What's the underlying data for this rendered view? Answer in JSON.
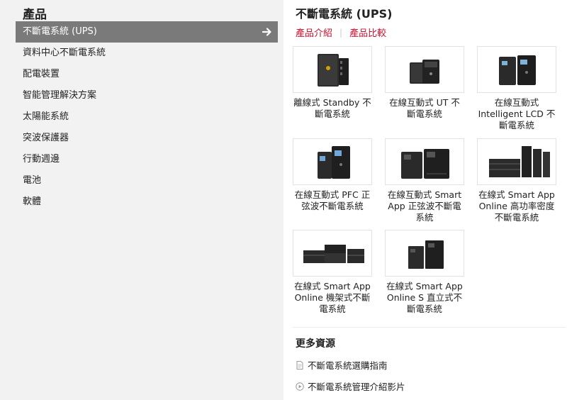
{
  "sidebar": {
    "title": "產品",
    "items": [
      {
        "label": "不斷電系統 (UPS)",
        "active": true
      },
      {
        "label": "資料中心不斷電系統"
      },
      {
        "label": "配電裝置"
      },
      {
        "label": "智能管理解決方案"
      },
      {
        "label": "太陽能系統"
      },
      {
        "label": "突波保護器"
      },
      {
        "label": "行動週邊"
      },
      {
        "label": "電池"
      },
      {
        "label": "軟體"
      }
    ]
  },
  "main": {
    "title": "不斷電系統 (UPS)",
    "tabs": [
      {
        "label": "產品介紹"
      },
      {
        "label": "產品比較"
      }
    ],
    "accent_color": "#c8102e",
    "products": [
      {
        "label": "離線式 Standby 不斷電系統",
        "image": "standby-ups-image"
      },
      {
        "label": "在線互動式 UT 不斷電系統",
        "image": "ut-ups-image"
      },
      {
        "label": "在線互動式 Intelligent LCD 不斷電系統",
        "image": "intelligent-lcd-ups-image"
      },
      {
        "label": "在線互動式 PFC 正弦波不斷電系統",
        "image": "pfc-ups-image"
      },
      {
        "label": "在線互動式 Smart App 正弦波不斷電系統",
        "image": "smart-app-sinewave-ups-image"
      },
      {
        "label": "在線式 Smart App Online 高功率密度不斷電系統",
        "image": "smart-app-online-high-density-ups-image"
      },
      {
        "label": "在線式 Smart App Online 機架式不斷電系統",
        "image": "smart-app-online-rackmount-ups-image"
      },
      {
        "label": "在線式 Smart App Online S 直立式不斷電系統",
        "image": "smart-app-online-s-tower-ups-image"
      }
    ]
  },
  "resources": {
    "title": "更多資源",
    "items": [
      {
        "label": "不斷電系統選購指南",
        "icon": "document-icon"
      },
      {
        "label": "不斷電系統管理介紹影片",
        "icon": "play-icon"
      }
    ]
  }
}
